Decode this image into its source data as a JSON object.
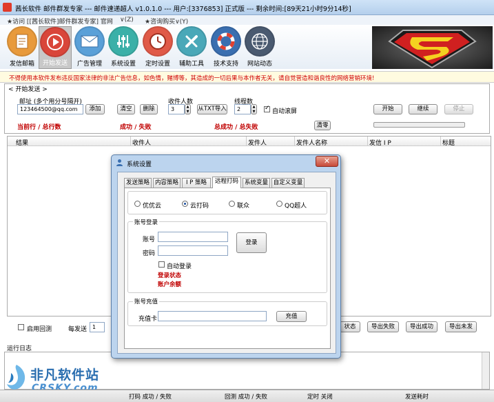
{
  "window": {
    "title": "茜长软件 邮件群发专家 --- 邮件速递超人 v1.0.1.0 --- 用户:[3376853] 正式版 --- 剩余时间:[89天21小时9分14秒]"
  },
  "linkbar": {
    "visit": "★访问 [[茜长软件]邮件群发专家] 官网",
    "visit_suffix": "∨(Z)",
    "contact": "★咨询购买∨(Y)"
  },
  "toolbar": {
    "items": [
      {
        "label": "发信邮箱",
        "icon": "document-icon",
        "color": "#e89a3c"
      },
      {
        "label": "开始发送",
        "icon": "play-icon",
        "color": "#d9463a"
      },
      {
        "label": "广告管理",
        "icon": "envelope-icon",
        "color": "#5aa0d8"
      },
      {
        "label": "系统设置",
        "icon": "sliders-icon",
        "color": "#3bb0a8"
      },
      {
        "label": "定时设置",
        "icon": "clock-icon",
        "color": "#e05a48"
      },
      {
        "label": "辅助工具",
        "icon": "wrench-icon",
        "color": "#4aa8b8"
      },
      {
        "label": "技术支持",
        "icon": "lifebuoy-icon",
        "color": "#3a6fb0"
      },
      {
        "label": "网站动态",
        "icon": "globe-icon",
        "color": "#4a5a70"
      }
    ]
  },
  "warning": "不得使用本软件发布违反国家法律的非法广告信息，如色情，赌博等，其造成的一切后果与本作者无关，请自觉营造和谐良性的网络营销环境!",
  "send": {
    "section": "< 开始发送 >",
    "email_label": "邮址 (多个用分号隔开)",
    "email_value": "123464500@qq.com",
    "add": "添加",
    "clear": "清空",
    "delete": "删除",
    "recipients_label": "收件人数",
    "recipients_value": "3",
    "import_txt": "从TXT导入",
    "threads_label": "线程数",
    "threads_value": "2",
    "autoscroll": "自动滚屏",
    "start": "开始",
    "continue": "继续",
    "stop": "停止",
    "current_total": "当前行 / 总行数",
    "success_fail": "成功 / 失败",
    "total_success_fail": "总成功 / 总失败",
    "clear_zero": "清零"
  },
  "grid": {
    "columns": [
      "结果",
      "收件人",
      "发件人",
      "发件人名称",
      "发信 I P",
      "标题"
    ]
  },
  "bottom": {
    "enable_reply": "启用回测",
    "per_send": "每发送",
    "per_send_value": "1",
    "status_btn": "状态",
    "export_fail": "导出失败",
    "export_success": "导出成功",
    "export_unsent": "导出未发"
  },
  "log": {
    "label": "运行日志"
  },
  "status": {
    "captcha": "打码 成功 / 失败",
    "reply": "回测 成功 / 失败",
    "timer": "定时 关闭",
    "elapsed": "发送耗时"
  },
  "watermark": {
    "cn": "非凡软件站",
    "en": "CRSKY.com"
  },
  "dialog": {
    "title": "系统设置",
    "close": "✕",
    "tabs": [
      "发送策略",
      "内容策略",
      "I P 策略",
      "远程打码",
      "系统变量",
      "自定义变量"
    ],
    "providers": [
      "优优云",
      "云打码",
      "联众",
      "QQ超人"
    ],
    "selected_provider": "云打码",
    "login_group": "账号登录",
    "account_label": "账号",
    "password_label": "密码",
    "login_btn": "登录",
    "auto_login": "自动登录",
    "login_status": "登录状态",
    "balance": "账户余额",
    "recharge_group": "账号充值",
    "card_label": "充值卡",
    "recharge_btn": "充值"
  }
}
